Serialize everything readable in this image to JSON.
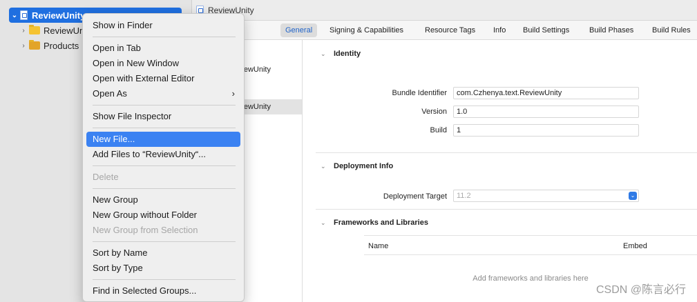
{
  "navigator": {
    "items": [
      {
        "label": "ReviewUnity",
        "expand": "⌄"
      },
      {
        "label": "ReviewUnity",
        "expand": "›"
      },
      {
        "label": "Products",
        "expand": "›"
      }
    ]
  },
  "pathbar": {
    "label": "ReviewUnity"
  },
  "tabs": [
    {
      "label": "General",
      "active": true
    },
    {
      "label": "Signing & Capabilities"
    },
    {
      "label": "Resource Tags"
    },
    {
      "label": "Info"
    },
    {
      "label": "Build Settings"
    },
    {
      "label": "Build Phases"
    },
    {
      "label": "Build Rules"
    }
  ],
  "targets": {
    "project": "ReviewUnity",
    "target": "ReviewUnity"
  },
  "identity": {
    "title": "Identity",
    "bundle_label": "Bundle Identifier",
    "bundle_value": "com.Czhenya.text.ReviewUnity",
    "version_label": "Version",
    "version_value": "1.0",
    "build_label": "Build",
    "build_value": "1"
  },
  "deployment": {
    "title": "Deployment Info",
    "target_label": "Deployment Target",
    "target_value": "11.2"
  },
  "frameworks": {
    "title": "Frameworks and Libraries",
    "col_name": "Name",
    "col_embed": "Embed",
    "empty": "Add frameworks and libraries here"
  },
  "context_menu": {
    "items": [
      {
        "label": "Show in Finder"
      },
      {
        "label": "Open in Tab"
      },
      {
        "label": "Open in New Window"
      },
      {
        "label": "Open with External Editor"
      },
      {
        "label": "Open As",
        "submenu": "›"
      },
      {
        "label": "Show File Inspector"
      },
      {
        "label": "New File...",
        "highlighted": true
      },
      {
        "label": "Add Files to “ReviewUnity“..."
      },
      {
        "label": "Delete",
        "disabled": true
      },
      {
        "label": "New Group"
      },
      {
        "label": "New Group without Folder"
      },
      {
        "label": "New Group from Selection",
        "disabled": true
      },
      {
        "label": "Sort by Name"
      },
      {
        "label": "Sort by Type"
      },
      {
        "label": "Find in Selected Groups..."
      }
    ]
  },
  "watermark": "CSDN @陈言必行",
  "colors": {
    "selection": "#1f6fe0",
    "menu_highlight": "#3b82f2",
    "accent_tab": "#1f63c9"
  },
  "icons": {
    "project": "xcode-project-icon",
    "folder": "folder-icon",
    "products": "products-folder-icon"
  }
}
